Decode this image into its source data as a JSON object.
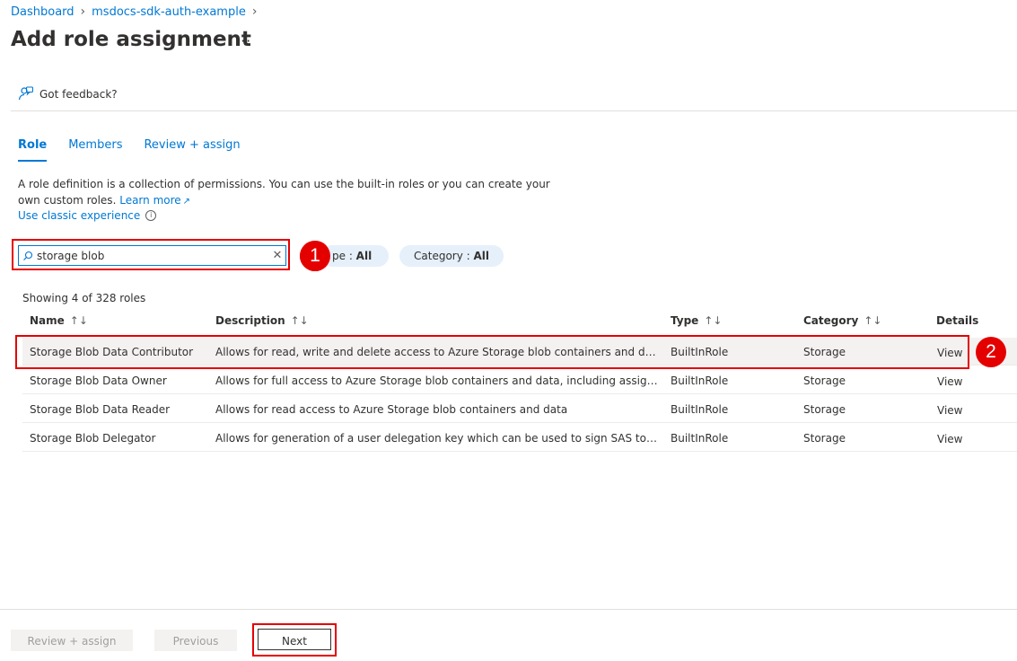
{
  "breadcrumb": {
    "items": [
      "Dashboard",
      "msdocs-sdk-auth-example"
    ]
  },
  "page": {
    "title": "Add role assignment",
    "more": "···"
  },
  "feedback": {
    "label": "Got feedback?"
  },
  "tabs": [
    {
      "label": "Role"
    },
    {
      "label": "Members"
    },
    {
      "label": "Review + assign"
    }
  ],
  "description": {
    "text": "A role definition is a collection of permissions. You can use the built-in roles or you can create your own custom roles.",
    "learn_more": "Learn more",
    "classic": "Use classic experience"
  },
  "search": {
    "value": "storage blob",
    "placeholder": ""
  },
  "callouts": [
    "1",
    "2"
  ],
  "filters": {
    "type": {
      "label": "pe : ",
      "value": "All"
    },
    "category": {
      "label": "Category : ",
      "value": "All"
    }
  },
  "results": {
    "count_text": "Showing 4 of 328 roles"
  },
  "table": {
    "headers": {
      "name": "Name",
      "description": "Description",
      "type": "Type",
      "category": "Category",
      "details": "Details"
    },
    "sort_glyph": "↑↓",
    "rows": [
      {
        "name": "Storage Blob Data Contributor",
        "description": "Allows for read, write and delete access to Azure Storage blob containers and data",
        "type": "BuiltInRole",
        "category": "Storage",
        "details": "View"
      },
      {
        "name": "Storage Blob Data Owner",
        "description": "Allows for full access to Azure Storage blob containers and data, including assigning ...",
        "type": "BuiltInRole",
        "category": "Storage",
        "details": "View"
      },
      {
        "name": "Storage Blob Data Reader",
        "description": "Allows for read access to Azure Storage blob containers and data",
        "type": "BuiltInRole",
        "category": "Storage",
        "details": "View"
      },
      {
        "name": "Storage Blob Delegator",
        "description": "Allows for generation of a user delegation key which can be used to sign SAS tokens",
        "type": "BuiltInRole",
        "category": "Storage",
        "details": "View"
      }
    ]
  },
  "footer": {
    "review_assign": "Review + assign",
    "previous": "Previous",
    "next": "Next"
  },
  "colors": {
    "accent": "#0078d4",
    "callout": "#e50000",
    "pill": "#e6f0fa"
  }
}
